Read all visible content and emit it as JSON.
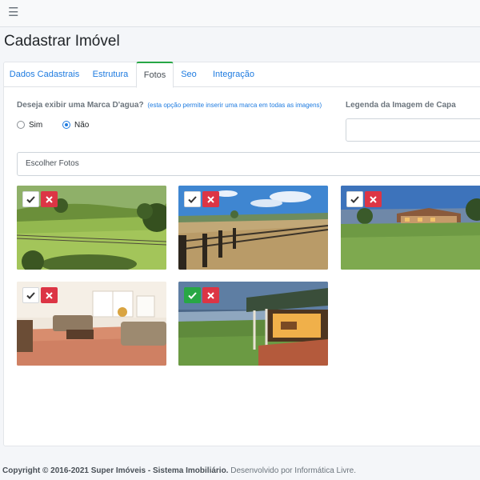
{
  "topbar": {
    "menu_icon": "hamburger-icon"
  },
  "page": {
    "title": "Cadastrar Imóvel"
  },
  "tabs": [
    {
      "label": "Dados Cadastrais",
      "active": false
    },
    {
      "label": "Estrutura",
      "active": false
    },
    {
      "label": "Fotos",
      "active": true
    },
    {
      "label": "Seo",
      "active": false
    },
    {
      "label": "Integração",
      "active": false
    }
  ],
  "watermark": {
    "question": "Deseja exibir uma Marca D'agua?",
    "note": "(esta opção permite inserir uma marca em todas as imagens)",
    "options": [
      {
        "label": "Sim",
        "checked": false
      },
      {
        "label": "Não",
        "checked": true
      }
    ]
  },
  "cover_caption": {
    "label": "Legenda da Imagem de Capa",
    "value": ""
  },
  "file_picker": {
    "label": "Escolher Fotos"
  },
  "photos": [
    {
      "scene": "pasture-hills",
      "cover": false
    },
    {
      "scene": "fence-field",
      "cover": false
    },
    {
      "scene": "ranch-house",
      "cover": false
    },
    {
      "scene": "living-room",
      "cover": false
    },
    {
      "scene": "veranda-lake",
      "cover": true
    }
  ],
  "colors": {
    "accent": "#1e7be0",
    "success": "#28a745",
    "danger": "#dc3545"
  },
  "footer": {
    "copyright": "Copyright © 2016-2021 Super Imóveis - Sistema Imobiliário.",
    "credit": "Desenvolvido por Informática Livre."
  }
}
